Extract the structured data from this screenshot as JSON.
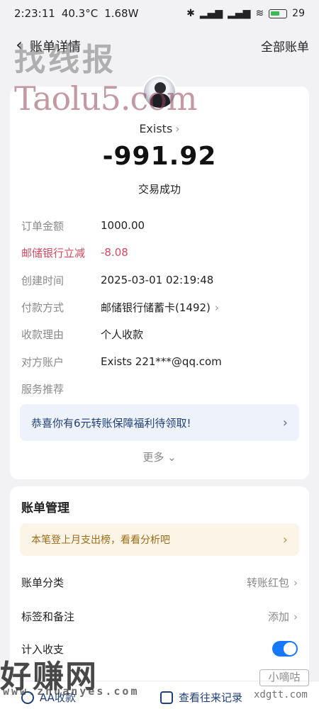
{
  "status_bar": {
    "time": "2:23:11",
    "temperature": "40.3°C",
    "power": "1.68W",
    "battery": "29"
  },
  "nav": {
    "title": "账单详情",
    "right": "全部账单"
  },
  "watermarks": {
    "top": "找线报",
    "taolu": "Taolu5.com",
    "haozhuan": "好赚网",
    "zhuan": "www.zhuanyes.com",
    "xiaodigu": "小嘀咕",
    "xdgtt": "xdgtt.com"
  },
  "transaction": {
    "payee": "Exists",
    "amount": "-991.92",
    "status": "交易成功"
  },
  "details": [
    {
      "label": "订单金额",
      "value": "1000.00"
    },
    {
      "label": "邮储银行立减",
      "value": "-8.08"
    },
    {
      "label": "创建时间",
      "value": "2025-03-01 02:19:48"
    },
    {
      "label": "付款方式",
      "value": "邮储银行储蓄卡(1492)"
    },
    {
      "label": "收款理由",
      "value": "个人收款"
    },
    {
      "label": "对方账户",
      "value": "Exists 221***@qq.com"
    },
    {
      "label": "服务推荐",
      "value": ""
    }
  ],
  "promo": "恭喜你有6元转账保障福利待领取!",
  "more": "更多",
  "management": {
    "title": "账单管理",
    "tip": "本笔登上月支出榜，看看分析吧",
    "category_label": "账单分类",
    "category_value": "转账红包",
    "tags_label": "标签和备注",
    "tags_value": "添加",
    "include_label": "计入收支"
  },
  "bottom": {
    "aa": "AA收款",
    "history": "查看往来记录"
  }
}
